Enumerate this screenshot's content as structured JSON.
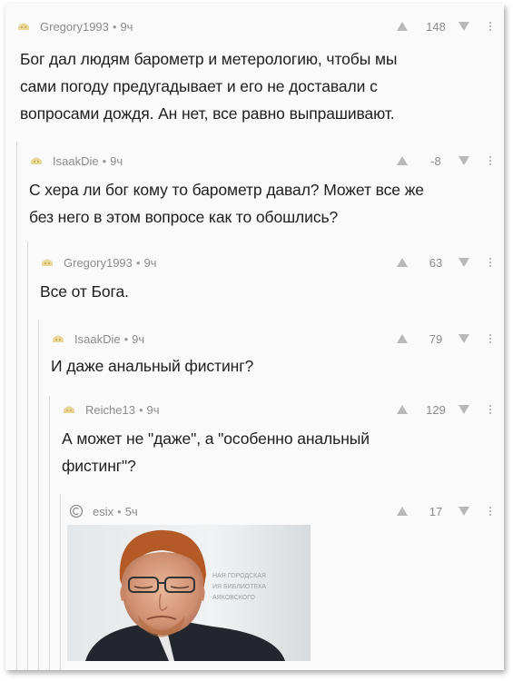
{
  "comments": [
    {
      "author": "Gregory1993",
      "time": "9ч",
      "score": "148",
      "text_lines": [
        "Бог дал людям барометр и метерологию, чтобы мы",
        "сами погоду предугадывает и его не доставали с",
        "вопросами дождя. Ан нет, все равно выпрашивают."
      ]
    },
    {
      "author": "IsaakDie",
      "time": "9ч",
      "score": "-8",
      "text_lines": [
        "С хера ли бог кому то барометр давал? Может все же",
        "без него в этом вопросе как то обошлись?"
      ]
    },
    {
      "author": "Gregory1993",
      "time": "9ч",
      "score": "63",
      "text_lines": [
        "Все от Бога."
      ]
    },
    {
      "author": "IsaakDie",
      "time": "9ч",
      "score": "79",
      "text_lines": [
        "И даже анальный фистинг?"
      ]
    },
    {
      "author": "Reiche13",
      "time": "9ч",
      "score": "129",
      "text_lines": [
        "А может не \"даже\", а \"особенно анальный",
        "фистинг\"?"
      ]
    },
    {
      "author": "esix",
      "time": "5ч",
      "score": "17",
      "text_lines": []
    }
  ],
  "separator": "•",
  "image_sign_lines": [
    "НАЯ ГОРОДСКАЯ",
    "ИЯ БИБЛИОТЕКА",
    "АЯКОВСКОГО"
  ],
  "colors": {
    "meta": "#8c8c8c",
    "vote_arrow": "#b8b8b8",
    "thread_line": "#d9d9d9"
  }
}
